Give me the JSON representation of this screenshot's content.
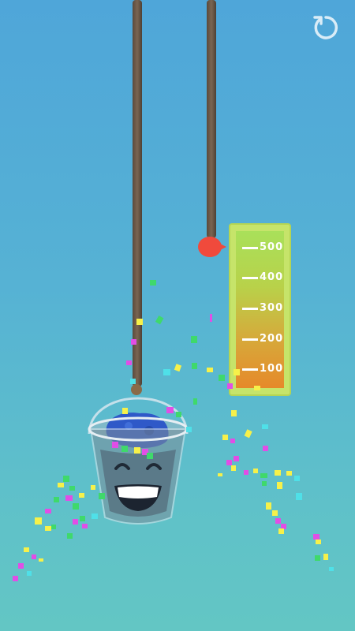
{
  "game": {
    "restart_icon": "restart-icon"
  },
  "meter": {
    "ticks": [
      "500",
      "400",
      "300",
      "200",
      "100"
    ],
    "fill_level_ml": 500,
    "colors": {
      "top": "#a9e05a",
      "bottom": "#e6892a",
      "frame": "#c6e46a"
    }
  },
  "marker": {
    "color": "#f04a3c"
  },
  "bucket": {
    "liquid_color": "#2f59c8",
    "face": "grinning"
  }
}
